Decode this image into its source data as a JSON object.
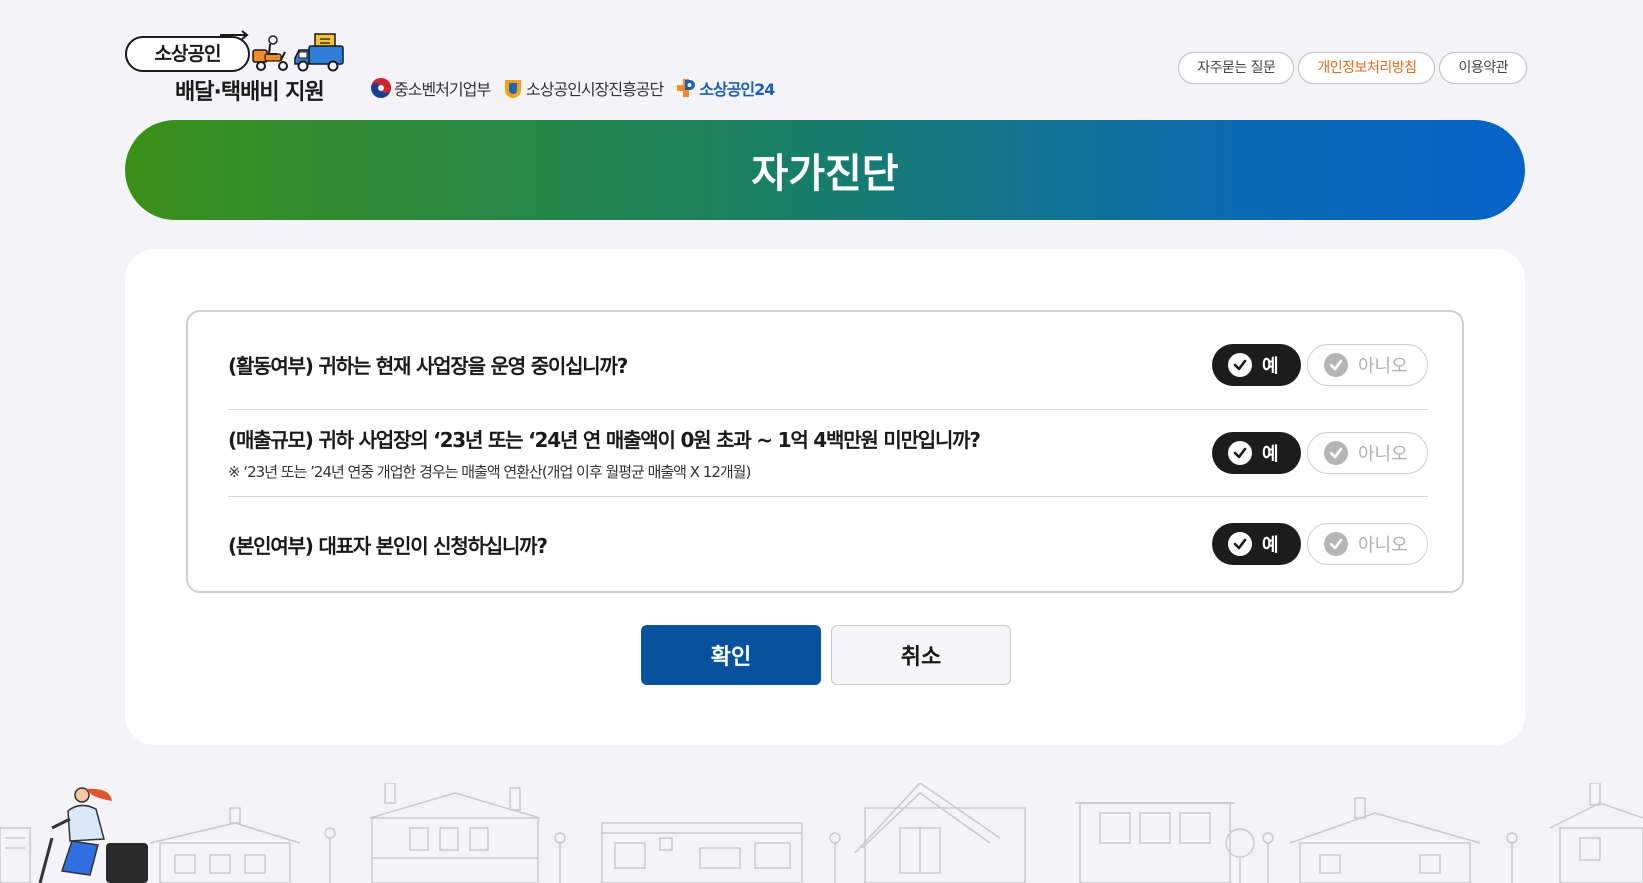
{
  "header": {
    "logo": {
      "top": "소상공인",
      "bottom": "배달·택배비 지원"
    },
    "partners": [
      {
        "name": "중소벤처기업부",
        "icon": "taegeuk-icon"
      },
      {
        "name": "소상공인시장진흥공단",
        "icon": "semas-icon"
      },
      {
        "name": "소상공인24",
        "icon": "p24-icon"
      }
    ],
    "nav": {
      "faq": "자주묻는 질문",
      "privacy": "개인정보처리방침",
      "terms": "이용약관"
    }
  },
  "banner": {
    "title": "자가진단"
  },
  "questions": [
    {
      "title": "(활동여부) 귀하는 현재 사업장을 운영 중이십니까?",
      "note": "",
      "yes": "예",
      "no": "아니오",
      "selected": "yes"
    },
    {
      "title": "(매출규모) 귀하 사업장의 ‘23년 또는 ‘24년 연 매출액이 0원 초과 ~ 1억 4백만원 미만입니까?",
      "note": "※ ‘23년 또는 ’24년 연중 개업한 경우는 매출액 연환산(개업 이후 월평균 매출액 X 12개월)",
      "yes": "예",
      "no": "아니오",
      "selected": "yes"
    },
    {
      "title": "(본인여부) 대표자 본인이 신청하십니까?",
      "note": "",
      "yes": "예",
      "no": "아니오",
      "selected": "yes"
    }
  ],
  "actions": {
    "confirm": "확인",
    "cancel": "취소"
  },
  "colors": {
    "banner_start": "#3a9018",
    "banner_end": "#0563c8",
    "primary_button": "#07529e",
    "selected_answer": "#1c1c1c",
    "privacy_link": "#e36b1c"
  }
}
